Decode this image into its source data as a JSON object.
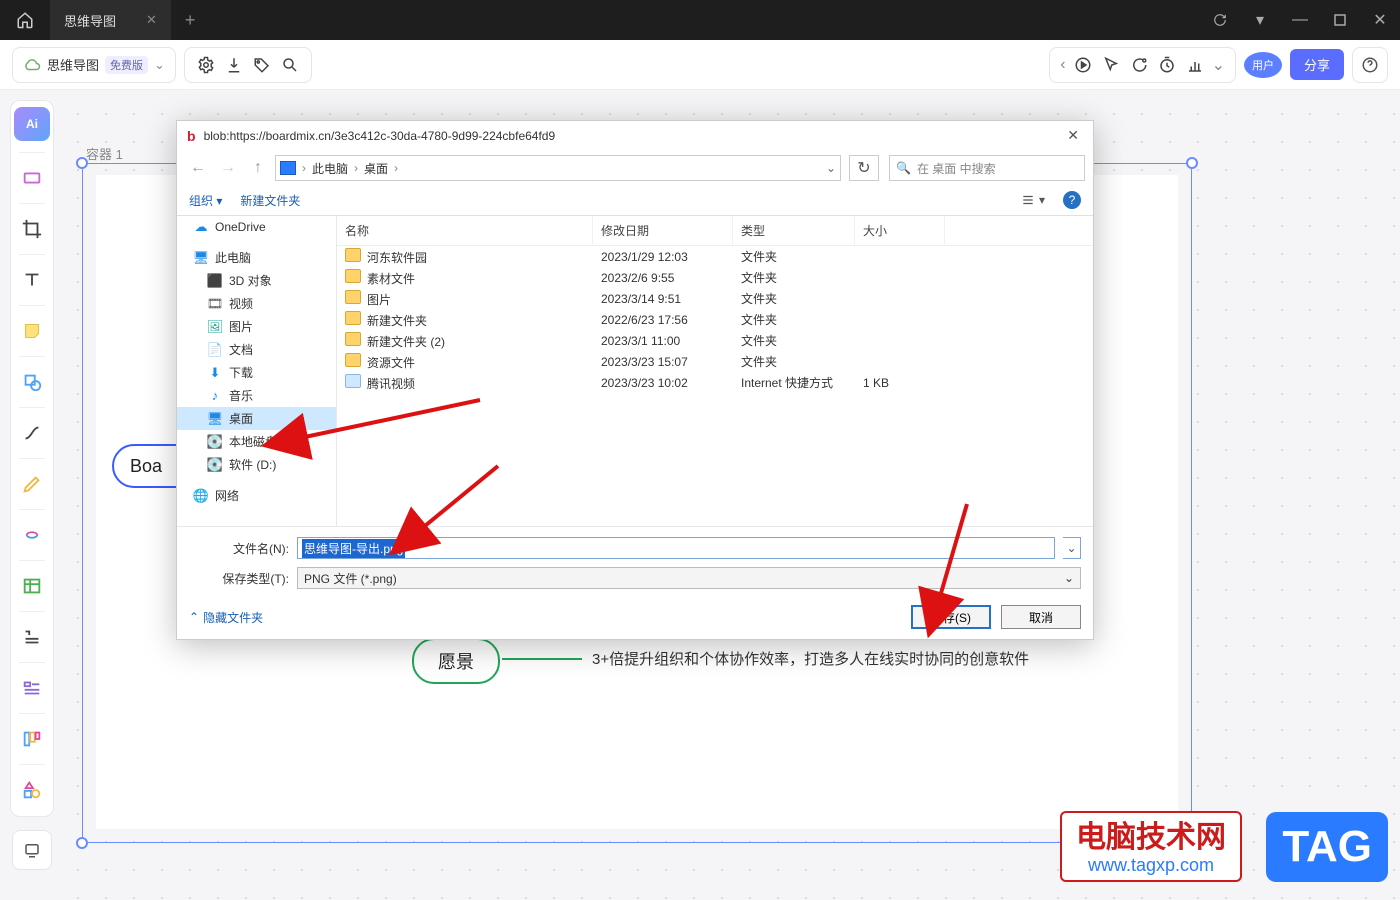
{
  "titlebar": {
    "tab_label": "思维导图"
  },
  "toolbar": {
    "doc_name": "思维导图",
    "free_badge": "免费版",
    "user_badge": "用户",
    "share_label": "分享"
  },
  "sidebar": {
    "ai_label": "Ai"
  },
  "canvas": {
    "container_label": "容器 1",
    "root_label": "Boa",
    "node_vision": "愿景",
    "vision_text": "3+倍提升组织和个体协作效率，打造多人在线实时协同的创意软件"
  },
  "dialog": {
    "title_url": "blob:https://boardmix.cn/3e3c412c-30da-4780-9d99-224cbfe64fd9",
    "crumb": {
      "pc": "此电脑",
      "desktop": "桌面"
    },
    "search_placeholder": "在 桌面 中搜索",
    "organize": "组织",
    "new_folder": "新建文件夹",
    "columns": {
      "name": "名称",
      "date": "修改日期",
      "type": "类型",
      "size": "大小"
    },
    "side": {
      "onedrive": "OneDrive",
      "pc": "此电脑",
      "obj3d": "3D 对象",
      "video": "视频",
      "pictures": "图片",
      "docs": "文档",
      "downloads": "下载",
      "music": "音乐",
      "desktop": "桌面",
      "cdrive": "本地磁盘 (C:)",
      "ddrive": "软件 (D:)",
      "network": "网络"
    },
    "rows": [
      {
        "name": "河东软件园",
        "date": "2023/1/29 12:03",
        "type": "文件夹",
        "size": ""
      },
      {
        "name": "素材文件",
        "date": "2023/2/6 9:55",
        "type": "文件夹",
        "size": ""
      },
      {
        "name": "图片",
        "date": "2023/3/14 9:51",
        "type": "文件夹",
        "size": ""
      },
      {
        "name": "新建文件夹",
        "date": "2022/6/23 17:56",
        "type": "文件夹",
        "size": ""
      },
      {
        "name": "新建文件夹 (2)",
        "date": "2023/3/1 11:00",
        "type": "文件夹",
        "size": ""
      },
      {
        "name": "资源文件",
        "date": "2023/3/23 15:07",
        "type": "文件夹",
        "size": ""
      },
      {
        "name": "腾讯视频",
        "date": "2023/3/23 10:02",
        "type": "Internet 快捷方式",
        "size": "1 KB"
      }
    ],
    "filename_label": "文件名(N):",
    "filename_value": "思维导图-导出.png",
    "filetype_label": "保存类型(T):",
    "filetype_value": "PNG 文件 (*.png)",
    "hide_folders": "隐藏文件夹",
    "save_btn": "保存(S)",
    "cancel_btn": "取消"
  },
  "watermark": {
    "line1": "电脑技术网",
    "line2": "www.tagxp.com",
    "tag": "TAG"
  }
}
